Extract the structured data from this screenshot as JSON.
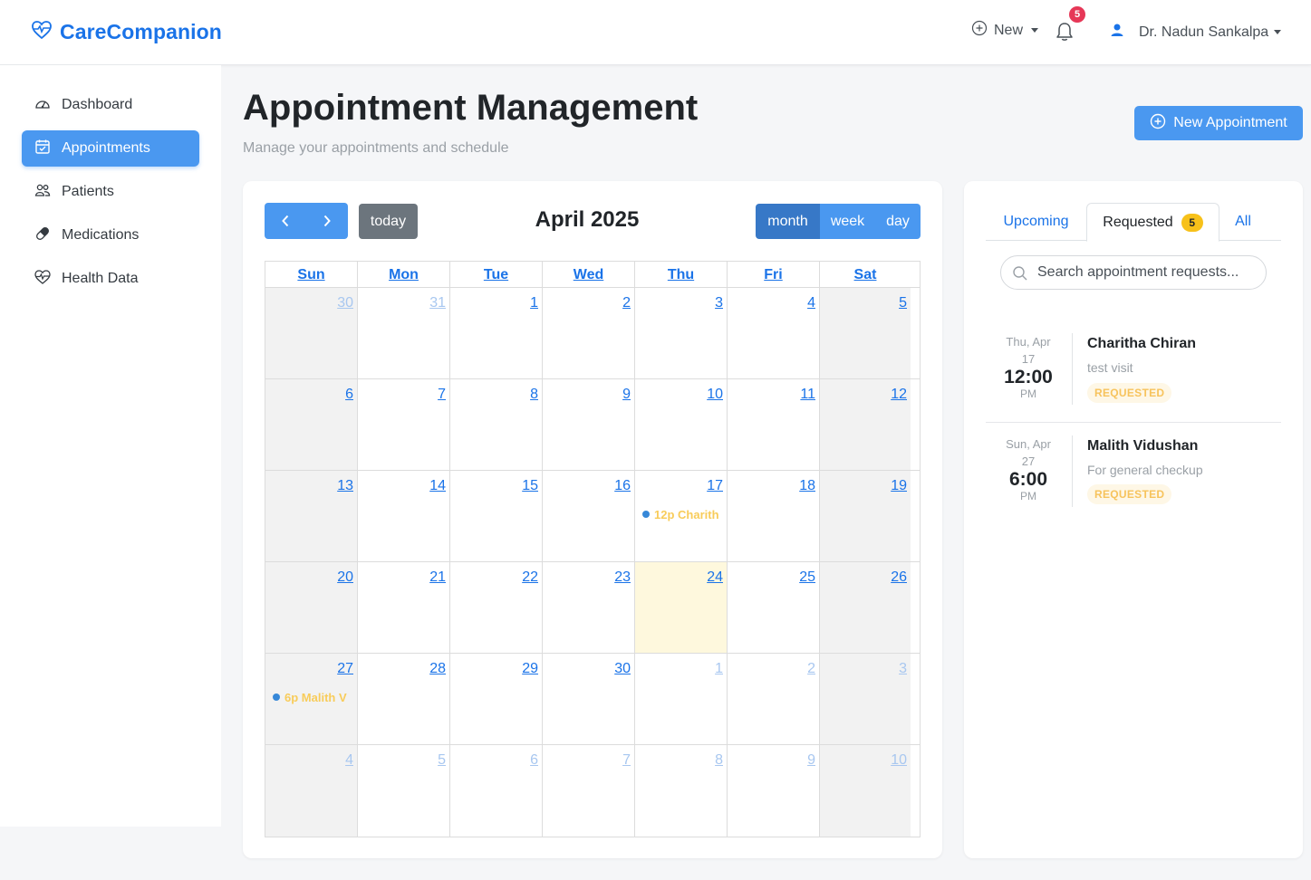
{
  "brand": {
    "name": "CareCompanion",
    "color": "#1a73e8"
  },
  "topbar": {
    "new_label": "New",
    "notifications_count": "5",
    "user_name": "Dr. Nadun Sankalpa"
  },
  "sidebar": {
    "items": [
      {
        "label": "Dashboard",
        "icon": "gauge-icon",
        "active": false
      },
      {
        "label": "Appointments",
        "icon": "calendar-check-icon",
        "active": true
      },
      {
        "label": "Patients",
        "icon": "people-icon",
        "active": false
      },
      {
        "label": "Medications",
        "icon": "capsule-icon",
        "active": false
      },
      {
        "label": "Health Data",
        "icon": "heart-pulse-icon",
        "active": false
      }
    ]
  },
  "header": {
    "title": "Appointment Management",
    "subtitle": "Manage your appointments and schedule",
    "new_appointment_label": "New Appointment"
  },
  "calendar": {
    "title": "April 2025",
    "today_label": "today",
    "views": [
      "month",
      "week",
      "day"
    ],
    "active_view": "month",
    "weekdays": [
      "Sun",
      "Mon",
      "Tue",
      "Wed",
      "Thu",
      "Fri",
      "Sat"
    ],
    "weeks": [
      [
        {
          "d": "30",
          "o": true
        },
        {
          "d": "31",
          "o": true
        },
        {
          "d": "1"
        },
        {
          "d": "2"
        },
        {
          "d": "3"
        },
        {
          "d": "4"
        },
        {
          "d": "5"
        }
      ],
      [
        {
          "d": "6"
        },
        {
          "d": "7"
        },
        {
          "d": "8"
        },
        {
          "d": "9"
        },
        {
          "d": "10"
        },
        {
          "d": "11"
        },
        {
          "d": "12"
        }
      ],
      [
        {
          "d": "13"
        },
        {
          "d": "14"
        },
        {
          "d": "15"
        },
        {
          "d": "16"
        },
        {
          "d": "17",
          "event": "12p Charith"
        },
        {
          "d": "18"
        },
        {
          "d": "19"
        }
      ],
      [
        {
          "d": "20"
        },
        {
          "d": "21"
        },
        {
          "d": "22"
        },
        {
          "d": "23"
        },
        {
          "d": "24",
          "today": true
        },
        {
          "d": "25"
        },
        {
          "d": "26"
        }
      ],
      [
        {
          "d": "27",
          "event": "6p Malith V"
        },
        {
          "d": "28"
        },
        {
          "d": "29"
        },
        {
          "d": "30"
        },
        {
          "d": "1",
          "o": true
        },
        {
          "d": "2",
          "o": true
        },
        {
          "d": "3",
          "o": true
        }
      ],
      [
        {
          "d": "4",
          "o": true
        },
        {
          "d": "5",
          "o": true
        },
        {
          "d": "6",
          "o": true
        },
        {
          "d": "7",
          "o": true
        },
        {
          "d": "8",
          "o": true
        },
        {
          "d": "9",
          "o": true
        },
        {
          "d": "10",
          "o": true
        }
      ]
    ]
  },
  "requests": {
    "tabs": [
      {
        "label": "Upcoming",
        "active": false
      },
      {
        "label": "Requested",
        "active": true,
        "badge": "5"
      },
      {
        "label": "All",
        "active": false
      }
    ],
    "search_placeholder": "Search appointment requests...",
    "items": [
      {
        "date": "Thu, Apr 17",
        "time": "12:00",
        "ampm": "PM",
        "name": "Charitha Chiran",
        "reason": "test visit",
        "status": "REQUESTED"
      },
      {
        "date": "Sun, Apr 27",
        "time": "6:00",
        "ampm": "PM",
        "name": "Malith Vidushan",
        "reason": "For general checkup",
        "status": "REQUESTED"
      }
    ]
  },
  "colors": {
    "accent": "#4a98f0",
    "today_bg": "#fef8dd",
    "event_text": "#f8cc5a",
    "status_bg": "#fef7e6"
  }
}
